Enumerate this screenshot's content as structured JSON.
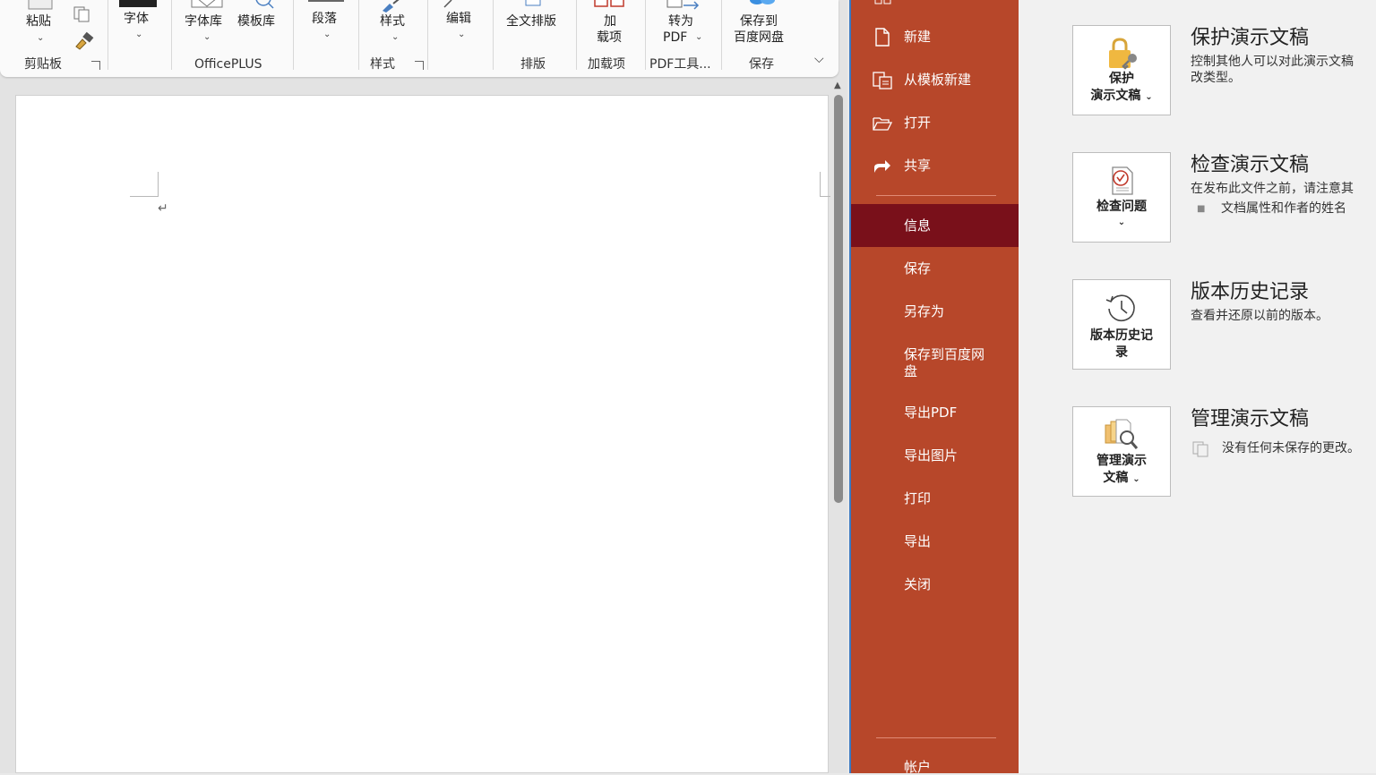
{
  "ribbon": {
    "groups": {
      "clipboard": {
        "label": "剪贴板",
        "paste": "粘贴"
      },
      "font": {
        "button": "字体"
      },
      "officeplus": {
        "label": "OfficePLUS",
        "fontlib": "字体库",
        "templatelib": "模板库"
      },
      "paragraph": {
        "button": "段落"
      },
      "styles": {
        "label": "样式",
        "button": "样式"
      },
      "editing": {
        "button": "编辑"
      },
      "layout": {
        "label": "排版",
        "button": "全文排版"
      },
      "addins": {
        "label": "加载项",
        "button_line1": "加",
        "button_line2": "载项"
      },
      "pdf": {
        "label": "PDF工具...",
        "button_line1": "转为",
        "button_line2": "PDF"
      },
      "save": {
        "label": "保存",
        "button_line1": "保存到",
        "button_line2": "百度网盘"
      }
    },
    "collapse_icon": "chevron-down-icon"
  },
  "document": {
    "paragraph_mark": "↵"
  },
  "backstage": {
    "nav": {
      "new": "新建",
      "from_template": "从模板新建",
      "open": "打开",
      "share": "共享",
      "info": "信息",
      "save": "保存",
      "save_as": "另存为",
      "save_baidu_line1": "保存到百度网",
      "save_baidu_line2": "盘",
      "export_pdf": "导出PDF",
      "export_image": "导出图片",
      "print": "打印",
      "export": "导出",
      "close": "关闭",
      "account": "帐户"
    },
    "sections": {
      "protect": {
        "button_line1": "保护",
        "button_line2": "演示文稿",
        "title": "保护演示文稿",
        "desc_line1": "控制其他人可以对此演示文稿",
        "desc_line2": "改类型。"
      },
      "inspect": {
        "button": "检查问题",
        "title": "检查演示文稿",
        "desc": "在发布此文件之前，请注意其",
        "bullet": "文档属性和作者的姓名"
      },
      "history": {
        "button_line1": "版本历史记",
        "button_line2": "录",
        "title": "版本历史记录",
        "desc": "查看并还原以前的版本。"
      },
      "manage": {
        "button_line1": "管理演示",
        "button_line2": "文稿",
        "title": "管理演示文稿",
        "desc": "没有任何未保存的更改。"
      }
    },
    "colors": {
      "nav_bg": "#b7472a",
      "nav_selected": "#79101a",
      "content_bg": "#f1f1f1"
    }
  }
}
